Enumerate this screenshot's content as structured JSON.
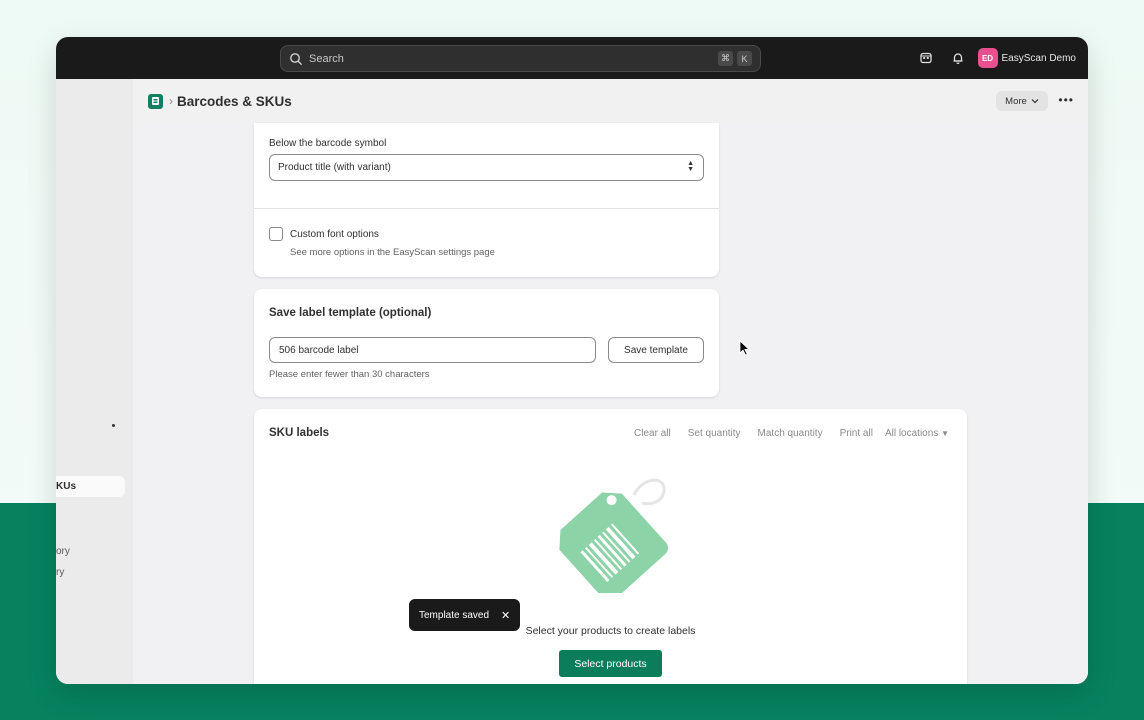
{
  "search": {
    "placeholder": "Search",
    "shortcut_keys": [
      "⌘",
      "K"
    ]
  },
  "store": {
    "badge": "ED",
    "name": "EasyScan Demo"
  },
  "sidebar": {
    "active_item_label": "KUs",
    "items": [
      "ory",
      "ry"
    ]
  },
  "header": {
    "title": "Barcodes & SKUs",
    "more_label": "More"
  },
  "barcode_card": {
    "below_label": "Below the barcode symbol",
    "below_value": "Product title (with variant)",
    "custom_font_label": "Custom font options",
    "custom_font_checked": false,
    "custom_font_help": "See more options in the EasyScan settings page"
  },
  "template_card": {
    "title": "Save label template (optional)",
    "input_value": "506 barcode label",
    "save_button": "Save template",
    "help": "Please enter fewer than 30 characters"
  },
  "sku_card": {
    "title": "SKU labels",
    "actions": [
      "Clear all",
      "Set quantity",
      "Match quantity",
      "Print all"
    ],
    "locations_label": "All locations",
    "empty_text": "Select your products to create labels",
    "select_button": "Select products"
  },
  "toast": {
    "message": "Template saved"
  },
  "colors": {
    "primary": "#0b7d5b",
    "background_green": "#06825f",
    "topbar": "#1a1a1a",
    "store_badge": "#e8508f",
    "tag_illustration": "#8dd3a8"
  },
  "icons": [
    "search-icon",
    "customer-view-icon",
    "bell-icon",
    "app-icon",
    "chevron-down-icon",
    "more-dots-icon",
    "tag-illustration",
    "close-icon",
    "mouse-cursor"
  ]
}
